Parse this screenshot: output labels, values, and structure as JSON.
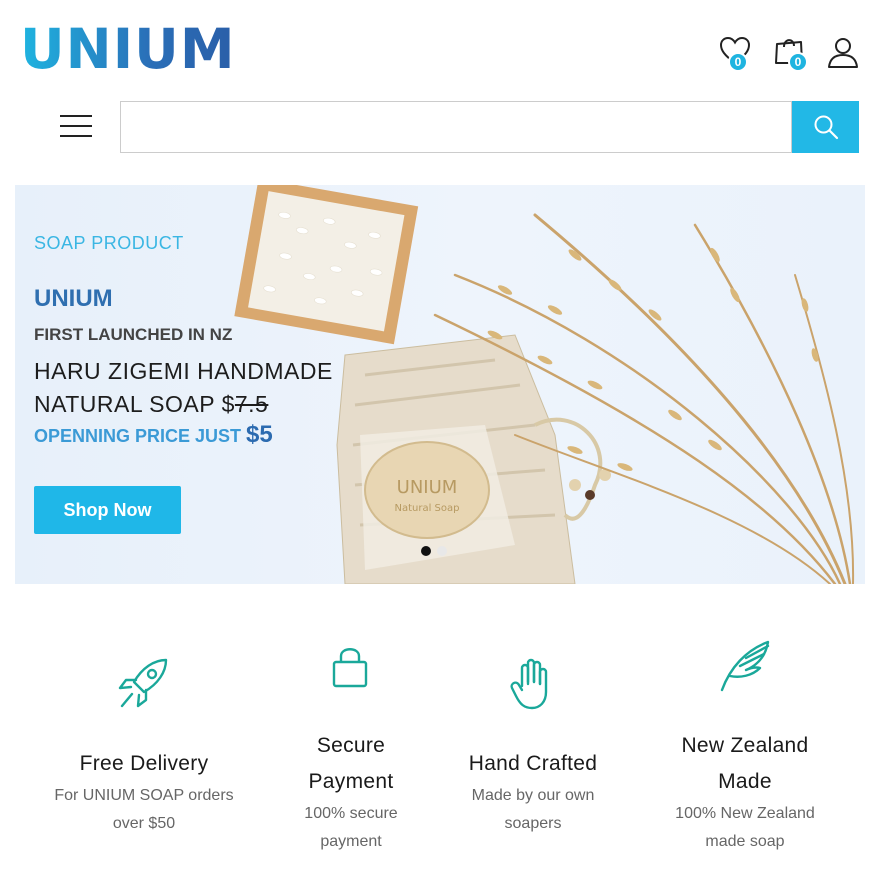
{
  "header": {
    "logo_text": "UNIUM",
    "wishlist_count": "0",
    "cart_count": "0",
    "icons": [
      "heart-icon",
      "shopping-bag-icon",
      "user-icon"
    ]
  },
  "search": {
    "value": "",
    "placeholder": ""
  },
  "hero": {
    "eyebrow": "SOAP PRODUCT",
    "brand": "UNIUM",
    "subtitle": "FIRST LAUNCHED IN NZ",
    "title_line1": "HARU ZIGEMI HANDMADE",
    "title_line2_prefix": "NATURAL SOAP $",
    "old_price": "7.5",
    "price_prefix": "OPENNING PRICE JUST ",
    "price": "$5",
    "cta_label": "Shop Now",
    "soap_text_line1": "UNIUM",
    "soap_text_line2": "Natural Soap",
    "slides": 2,
    "active_slide": 1
  },
  "features": [
    {
      "icon": "rocket-icon",
      "title": "Free Delivery",
      "desc": "For UNIUM SOAP orders over $50"
    },
    {
      "icon": "lock-icon",
      "title": "Secure Payment",
      "desc": "100% secure payment"
    },
    {
      "icon": "hand-icon",
      "title": "Hand Crafted",
      "desc": "Made by our own soapers"
    },
    {
      "icon": "feather-icon",
      "title": "New Zealand Made",
      "desc": "100% New Zealand made soap"
    }
  ],
  "colors": {
    "accent": "#22b8e6",
    "brand_blue": "#2f6fb0",
    "feature_icon": "#1aa89a"
  }
}
